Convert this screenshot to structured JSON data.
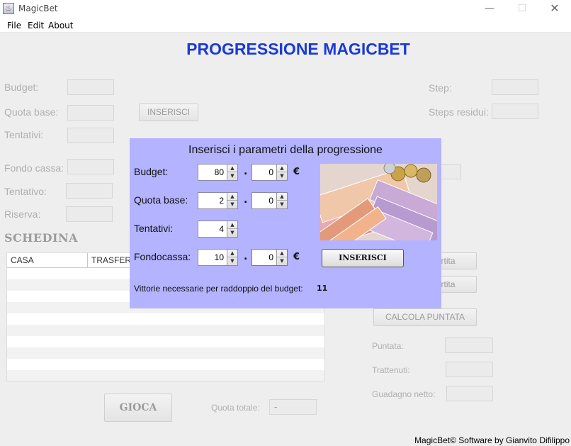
{
  "window": {
    "title": "MagicBet",
    "minimize": "—",
    "maximize": "☐",
    "close": "✕"
  },
  "menu": [
    "File",
    "Edit",
    "About"
  ],
  "heading": "PROGRESSIONE MAGICBET",
  "left_form": {
    "budget_label": "Budget:",
    "quota_base_label": "Quota base:",
    "tentativi_label": "Tentativi:",
    "fondo_cassa_label": "Fondo cassa:",
    "tentativo_label": "Tentativo:",
    "riserva_label": "Riserva:",
    "inserisci_label": "INSERISCI"
  },
  "right_form": {
    "step_label": "Step:",
    "steps_residui_label": "Steps residui:",
    "partita_btn1": "rtita",
    "partita_btn2": "rtita",
    "calcola_label": "CALCOLA PUNTATA",
    "puntata_label": "Puntata:",
    "trattenuti_label": "Trattenuti:",
    "guadagno_label": "Guadagno netto:"
  },
  "schedina": {
    "title": "SCHEDINA",
    "columns": [
      "CASA",
      "TRASFER"
    ]
  },
  "bottom": {
    "gioca_label": "GIOCA",
    "quota_totale_label": "Quota totale:",
    "quota_totale_value": "-"
  },
  "dialog": {
    "title": "Inserisci i parametri della progressione",
    "budget_label": "Budget:",
    "budget_int": "80",
    "budget_dec": "0",
    "quota_base_label": "Quota base:",
    "quota_int": "2",
    "quota_dec": "0",
    "tentativi_label": "Tentativi:",
    "tentativi_value": "4",
    "fondocassa_label": "Fondocassa:",
    "fondocassa_int": "10",
    "fondocassa_dec": "0",
    "dot": ".",
    "currency": "€",
    "inserisci_label": "INSERISCI",
    "vittorie_label": "Vittorie necessarie per raddoppio del budget:",
    "vittorie_value": "11"
  },
  "footer": "MagicBet© Software by Gianvito Difilippo",
  "colors": {
    "heading": "#1a3ad6",
    "dialog_bg": "#b3b3ff",
    "window_bg": "#eeeeee"
  }
}
